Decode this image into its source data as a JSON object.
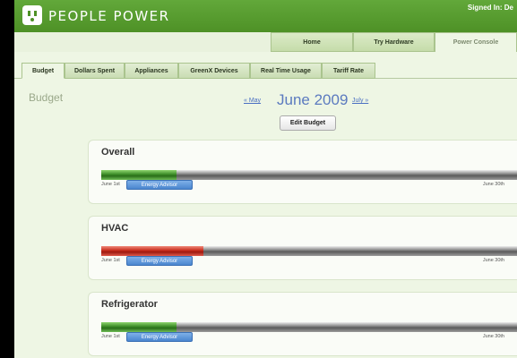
{
  "header": {
    "brand": "PEOPLE POWER",
    "signed_in": "Signed In: De"
  },
  "main_nav": [
    {
      "label": "Home",
      "active": false
    },
    {
      "label": "Try Hardware",
      "active": false
    },
    {
      "label": "Power Console",
      "active": true
    }
  ],
  "sub_tabs": [
    {
      "label": "Budget",
      "active": true
    },
    {
      "label": "Dollars Spent",
      "active": false
    },
    {
      "label": "Appliances",
      "active": false
    },
    {
      "label": "GreenX Devices",
      "active": false
    },
    {
      "label": "Real Time Usage",
      "active": false
    },
    {
      "label": "Tariff Rate",
      "active": false
    }
  ],
  "sidebar": {
    "title": "Budget"
  },
  "month_nav": {
    "prev": "« May",
    "title": "June 2009",
    "next": "July »"
  },
  "edit_button": "Edit Budget",
  "panels": [
    {
      "title": "Overall",
      "fill_fraction": 0.18,
      "fill_color": "green",
      "start_label": "June 1st",
      "end_label": "June 30th",
      "advisor_label": "Energy Advisor"
    },
    {
      "title": "HVAC",
      "fill_fraction": 0.245,
      "fill_color": "red",
      "start_label": "June 1st",
      "end_label": "June 30th",
      "advisor_label": "Energy Advisor"
    },
    {
      "title": "Refrigerator",
      "fill_fraction": 0.18,
      "fill_color": "green",
      "start_label": "June 1st",
      "end_label": "June 30th",
      "advisor_label": "Energy Advisor"
    }
  ],
  "colors": {
    "header_green": "#4e9126",
    "page_bg": "#eef6e4",
    "link_blue": "#4a6fc2",
    "advisor_blue": "#4a86cf",
    "over_budget_red": "#c62a1a"
  }
}
